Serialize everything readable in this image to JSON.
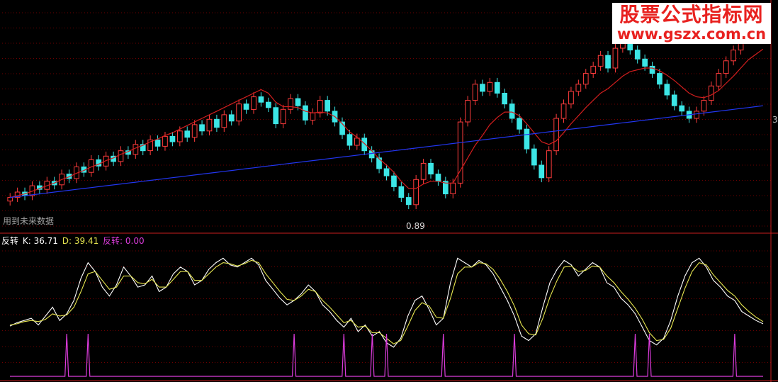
{
  "watermark": {
    "line1": "股票公式指标网",
    "line2": "www.gszx.com.cn"
  },
  "main_panel": {
    "note_text": "用到未来数据",
    "low_marker": "0.89",
    "right_edge_label": "3"
  },
  "indicator_panel": {
    "name": "反转",
    "k_label": "K: 36.71",
    "d_label": "D: 39.41",
    "fz_label": "反转: 0.00"
  },
  "colors": {
    "background": "#000000",
    "up_candle": "#ff3c3c",
    "down_candle": "#3ce6e6",
    "ma_short": "#d21e1e",
    "ma_long": "#2236f0",
    "grid": "#6e0000",
    "k_line": "#ffffff",
    "d_line": "#e6e650",
    "signal": "#dc3cdc",
    "panel_divider": "#c81e1e"
  },
  "chart_data": [
    {
      "type": "candlestick",
      "description_series": "price",
      "series": [
        {
          "name": "price",
          "close": [
            10,
            10.6,
            10.2,
            11.3,
            10.9,
            11.8,
            11.4,
            12.6,
            12.1,
            13.4,
            12.8,
            14.2,
            13.5,
            14.6,
            14,
            15.2,
            14.8,
            15.9,
            15.2,
            16.4,
            15.7,
            16.8,
            16.2,
            17.4,
            16.7,
            18.1,
            17.4,
            18.7,
            17.8,
            19.2,
            18.5,
            20.4,
            19.8,
            21.2,
            20.6,
            20,
            18.2,
            19.8,
            21,
            20.2,
            18.6,
            19.4,
            20.8,
            19.6,
            18.4,
            17,
            15.8,
            16.6,
            15.2,
            14.4,
            13.2,
            12.4,
            11.2,
            10,
            9.2,
            12,
            13.8,
            12.6,
            11.8,
            10.4,
            11.6,
            18.4,
            20.8,
            22.6,
            21.8,
            22.8,
            21.6,
            20.4,
            18.8,
            17.6,
            15.4,
            13.6,
            12.2,
            15.2,
            18.8,
            20.4,
            21.8,
            22.6,
            23.8,
            24.6,
            25.8,
            24.4,
            26.6,
            27.8,
            26.4,
            25.4,
            24.6,
            23.8,
            22.6,
            21.4,
            20.2,
            19.6,
            18.8,
            19.6,
            20.8,
            22.4,
            23.8,
            25.2,
            26.4,
            27.6,
            28.2,
            27.6,
            28.4
          ]
        },
        {
          "name": "ma_short",
          "values": [
            10,
            10.2,
            10.4,
            10.7,
            11,
            11.3,
            11.6,
            12,
            12.3,
            12.7,
            13,
            13.4,
            13.7,
            14.1,
            14.4,
            14.8,
            15.1,
            15.5,
            15.8,
            16.2,
            16.5,
            16.9,
            17.2,
            17.6,
            18,
            18.4,
            18.8,
            19.2,
            19.6,
            20,
            20.4,
            20.8,
            21.2,
            21.6,
            22,
            21.6,
            20.6,
            20.1,
            20.1,
            20,
            19.6,
            19.4,
            19.5,
            19.4,
            19,
            18.2,
            17.3,
            16.7,
            16,
            15.2,
            14.3,
            13.6,
            12.8,
            11.8,
            11,
            11,
            11.5,
            11.8,
            11.8,
            11.6,
            11.6,
            13,
            14.4,
            15.8,
            16.9,
            18.1,
            18.9,
            19.5,
            19.5,
            19.1,
            18.2,
            17.2,
            16.2,
            15.9,
            16.3,
            17.2,
            18.2,
            19.1,
            20,
            20.8,
            21.6,
            22.1,
            22.8,
            23.5,
            24,
            24.2,
            24.4,
            24.4,
            24.1,
            23.6,
            23,
            22.3,
            21.6,
            21.2,
            21.1,
            21.4,
            21.9,
            22.7,
            23.5,
            24.4,
            25.3,
            25.9,
            26.5
          ]
        },
        {
          "name": "ma_long",
          "values": [
            10,
            10.1,
            10.2,
            10.3,
            10.4,
            10.5,
            10.6,
            10.7,
            10.8,
            10.9,
            11,
            11.1,
            11.2,
            11.3,
            11.4,
            11.5,
            11.6,
            11.7,
            11.8,
            11.9,
            12,
            12.1,
            12.2,
            12.3,
            12.4,
            12.5,
            12.6,
            12.7,
            12.8,
            12.9,
            13,
            13.1,
            13.2,
            13.3,
            13.4,
            13.5,
            13.6,
            13.7,
            13.8,
            13.9,
            14,
            14.1,
            14.2,
            14.3,
            14.4,
            14.5,
            14.6,
            14.7,
            14.8,
            14.9,
            15,
            15.1,
            15.2,
            15.3,
            15.4,
            15.5,
            15.6,
            15.7,
            15.8,
            15.9,
            16,
            16.1,
            16.2,
            16.3,
            16.4,
            16.5,
            16.6,
            16.7,
            16.8,
            16.9,
            17,
            17.1,
            17.2,
            17.3,
            17.4,
            17.5,
            17.6,
            17.7,
            17.8,
            17.9,
            18,
            18.1,
            18.2,
            18.3,
            18.4,
            18.5,
            18.6,
            18.7,
            18.8,
            18.9,
            19,
            19.1,
            19.2,
            19.3,
            19.4,
            19.5,
            19.6,
            19.7,
            19.8,
            19.9,
            20,
            20.1,
            20.2
          ]
        }
      ],
      "annotations": [
        "用到未来数据",
        "0.89"
      ],
      "grid": true
    },
    {
      "type": "line",
      "series": [
        {
          "name": "K",
          "values": [
            35,
            38,
            40,
            42,
            36,
            44,
            52,
            40,
            46,
            58,
            78,
            92,
            84,
            70,
            62,
            72,
            88,
            80,
            70,
            72,
            80,
            66,
            70,
            82,
            88,
            84,
            72,
            76,
            86,
            92,
            96,
            90,
            88,
            92,
            96,
            90,
            76,
            68,
            60,
            54,
            58,
            64,
            72,
            66,
            54,
            48,
            40,
            34,
            42,
            30,
            36,
            26,
            30,
            20,
            16,
            24,
            44,
            58,
            62,
            50,
            36,
            42,
            74,
            96,
            92,
            88,
            94,
            90,
            82,
            70,
            58,
            44,
            26,
            22,
            28,
            52,
            74,
            86,
            94,
            90,
            80,
            86,
            92,
            88,
            74,
            70,
            60,
            54,
            46,
            34,
            22,
            18,
            24,
            40,
            62,
            80,
            92,
            96,
            88,
            76,
            70,
            62,
            58,
            48,
            44,
            40,
            37
          ]
        },
        {
          "name": "D",
          "values": [
            36,
            37,
            39,
            40,
            39,
            41,
            46,
            44,
            45,
            52,
            66,
            82,
            84,
            76,
            68,
            70,
            80,
            80,
            74,
            73,
            77,
            70,
            70,
            77,
            84,
            84,
            76,
            76,
            82,
            88,
            92,
            91,
            89,
            91,
            94,
            92,
            82,
            74,
            66,
            59,
            58,
            62,
            68,
            66,
            58,
            52,
            45,
            38,
            40,
            34,
            35,
            29,
            29,
            24,
            19,
            22,
            35,
            49,
            56,
            53,
            43,
            42,
            60,
            82,
            88,
            88,
            92,
            91,
            86,
            77,
            66,
            53,
            36,
            28,
            27,
            42,
            61,
            76,
            88,
            89,
            84,
            85,
            89,
            88,
            80,
            74,
            66,
            59,
            51,
            41,
            29,
            22,
            23,
            33,
            51,
            69,
            84,
            92,
            90,
            81,
            74,
            67,
            62,
            54,
            48,
            43,
            39
          ]
        },
        {
          "name": "反转",
          "values": [
            0,
            0,
            0,
            0,
            0,
            0,
            0,
            0,
            1,
            0,
            0,
            1,
            0,
            0,
            0,
            0,
            0,
            0,
            0,
            0,
            0,
            0,
            0,
            0,
            0,
            0,
            0,
            0,
            0,
            0,
            0,
            0,
            0,
            0,
            0,
            0,
            0,
            0,
            0,
            0,
            1,
            0,
            0,
            0,
            0,
            0,
            0,
            1,
            0,
            0,
            0,
            1,
            0,
            1,
            0,
            0,
            0,
            0,
            0,
            0,
            0,
            1,
            0,
            0,
            0,
            0,
            0,
            0,
            0,
            0,
            0,
            1,
            0,
            0,
            0,
            0,
            0,
            0,
            0,
            0,
            0,
            0,
            0,
            0,
            0,
            0,
            0,
            0,
            1,
            0,
            1,
            0,
            0,
            0,
            0,
            0,
            0,
            0,
            0,
            0,
            0,
            0,
            1,
            0,
            0,
            0,
            0
          ]
        }
      ],
      "legend": [
        "反转",
        "K: 36.71",
        "D: 39.41",
        "反转: 0.00"
      ],
      "grid": true
    }
  ]
}
